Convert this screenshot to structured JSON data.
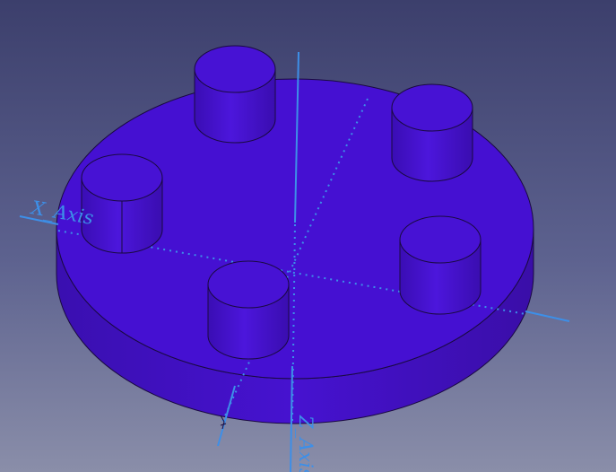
{
  "viewport": {
    "background_top": "#3c3f6c",
    "background_bottom": "#8a8ea9"
  },
  "model": {
    "color": "#4a10d8",
    "edge_color": "#1a0a40"
  },
  "axes": {
    "color": "#3d8fe8",
    "x_label": "X_Axis",
    "z_label": "Z_Axis"
  }
}
